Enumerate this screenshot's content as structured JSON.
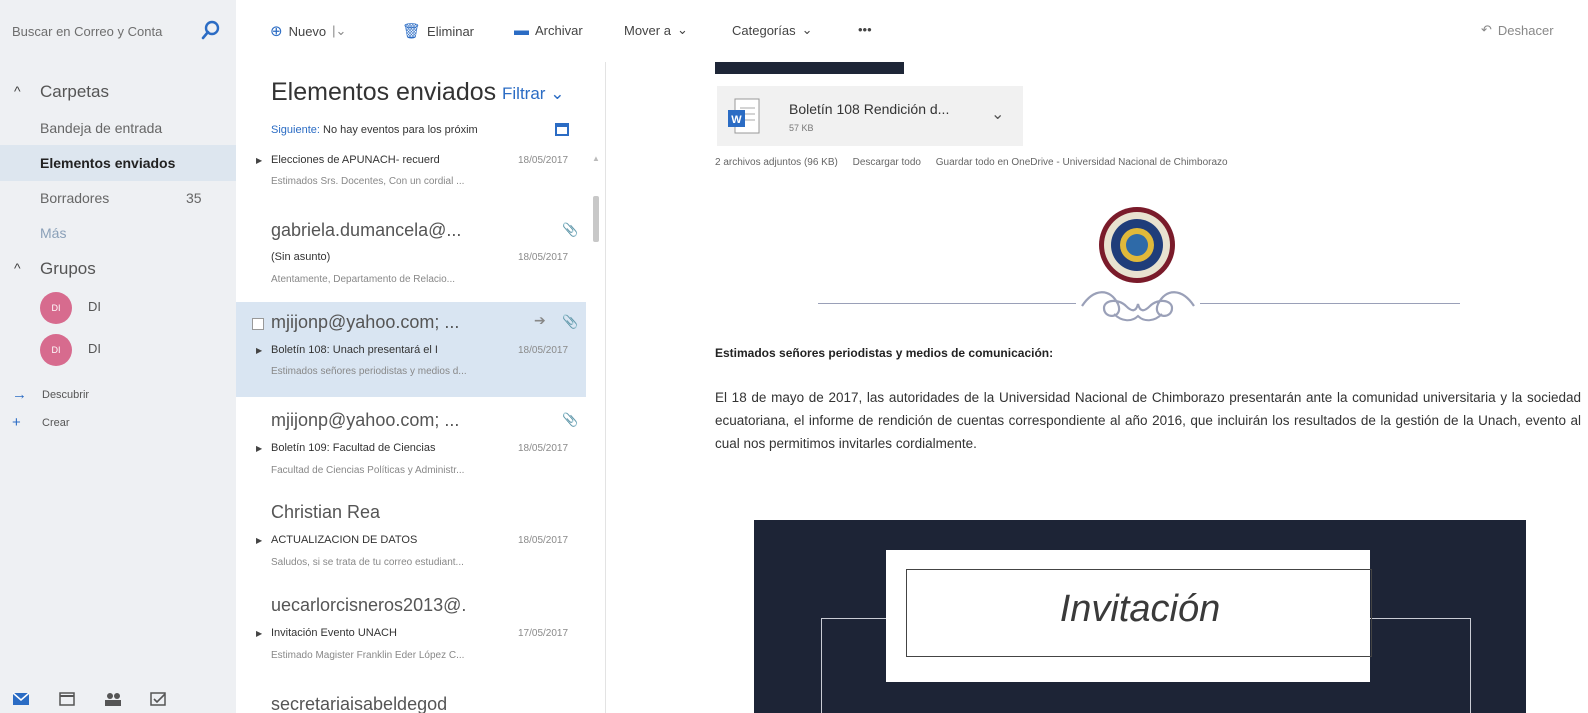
{
  "search": {
    "placeholder": "Buscar en Correo y Conta"
  },
  "toolbar": {
    "new_label": "Nuevo",
    "delete_label": "Eliminar",
    "archive_label": "Archivar",
    "move_label": "Mover a",
    "categories_label": "Categorías",
    "more_label": "•••",
    "undo_label": "Deshacer"
  },
  "sidebar": {
    "folders_header": "Carpetas",
    "inbox": "Bandeja de entrada",
    "sent": "Elementos enviados",
    "drafts": "Borradores",
    "drafts_count": "35",
    "more": "Más",
    "groups_header": "Grupos",
    "groups": [
      {
        "initials": "DI",
        "name": "DI"
      },
      {
        "initials": "DI",
        "name": "DI"
      }
    ],
    "discover": "Descubrir",
    "create": "Crear"
  },
  "list": {
    "title": "Elementos enviados",
    "filter_label": "Filtrar",
    "next_key": "Siguiente:",
    "next_text": "No hay eventos para los próxim",
    "messages": [
      {
        "from": "",
        "subject": "Elecciones de APUNACH- recuerd",
        "date": "18/05/2017",
        "preview": "Estimados Srs. Docentes,  Con un cordial ..."
      },
      {
        "from": "gabriela.dumancela@...",
        "subject": "(Sin asunto)",
        "date": "18/05/2017",
        "preview": "Atentamente,  Departamento de Relacio..."
      },
      {
        "from": "mjijonp@yahoo.com; ...",
        "subject": "Boletín 108: Unach presentará el I",
        "date": "18/05/2017",
        "preview": "Estimados señores periodistas y medios d..."
      },
      {
        "from": "mjijonp@yahoo.com; ...",
        "subject": "Boletín 109: Facultad de Ciencias",
        "date": "18/05/2017",
        "preview": "Facultad de Ciencias Políticas y Administr..."
      },
      {
        "from": "Christian Rea",
        "subject": "ACTUALIZACION DE DATOS",
        "date": "18/05/2017",
        "preview": "Saludos, si se trata de tu correo estudiant..."
      },
      {
        "from": "uecarlorcisneros2013@.",
        "subject": "Invitación Evento UNACH",
        "date": "17/05/2017",
        "preview": "Estimado Magister Franklin Eder López C..."
      },
      {
        "from": "secretariaisabeldegod",
        "subject": "",
        "date": "",
        "preview": ""
      }
    ]
  },
  "pane": {
    "attachment_name": "Boletín 108 Rendición d...",
    "attachment_size": "57 KB",
    "attachments_info": "2 archivos adjuntos (96 KB)",
    "download_all": "Descargar todo",
    "save_onedrive": "Guardar todo en OneDrive - Universidad Nacional de Chimborazo",
    "greeting": "Estimados señores periodistas y medios de comunicación:",
    "body": "El 18 de mayo de 2017, las autoridades de la Universidad Nacional de Chimborazo presentarán ante la comunidad universitaria y la sociedad ecuatoriana, el informe de rendición de cuentas correspondiente al año 2016, que incluirán los resultados de la gestión de la Unach, evento al cual nos permitimos invitarles cordialmente.",
    "invite_title": "Invitación"
  },
  "colors": {
    "accent": "#2b6cc4",
    "selected_bg": "#d9e5f2",
    "avatar": "#d76b8e",
    "invite_bg": "#1d2436"
  }
}
